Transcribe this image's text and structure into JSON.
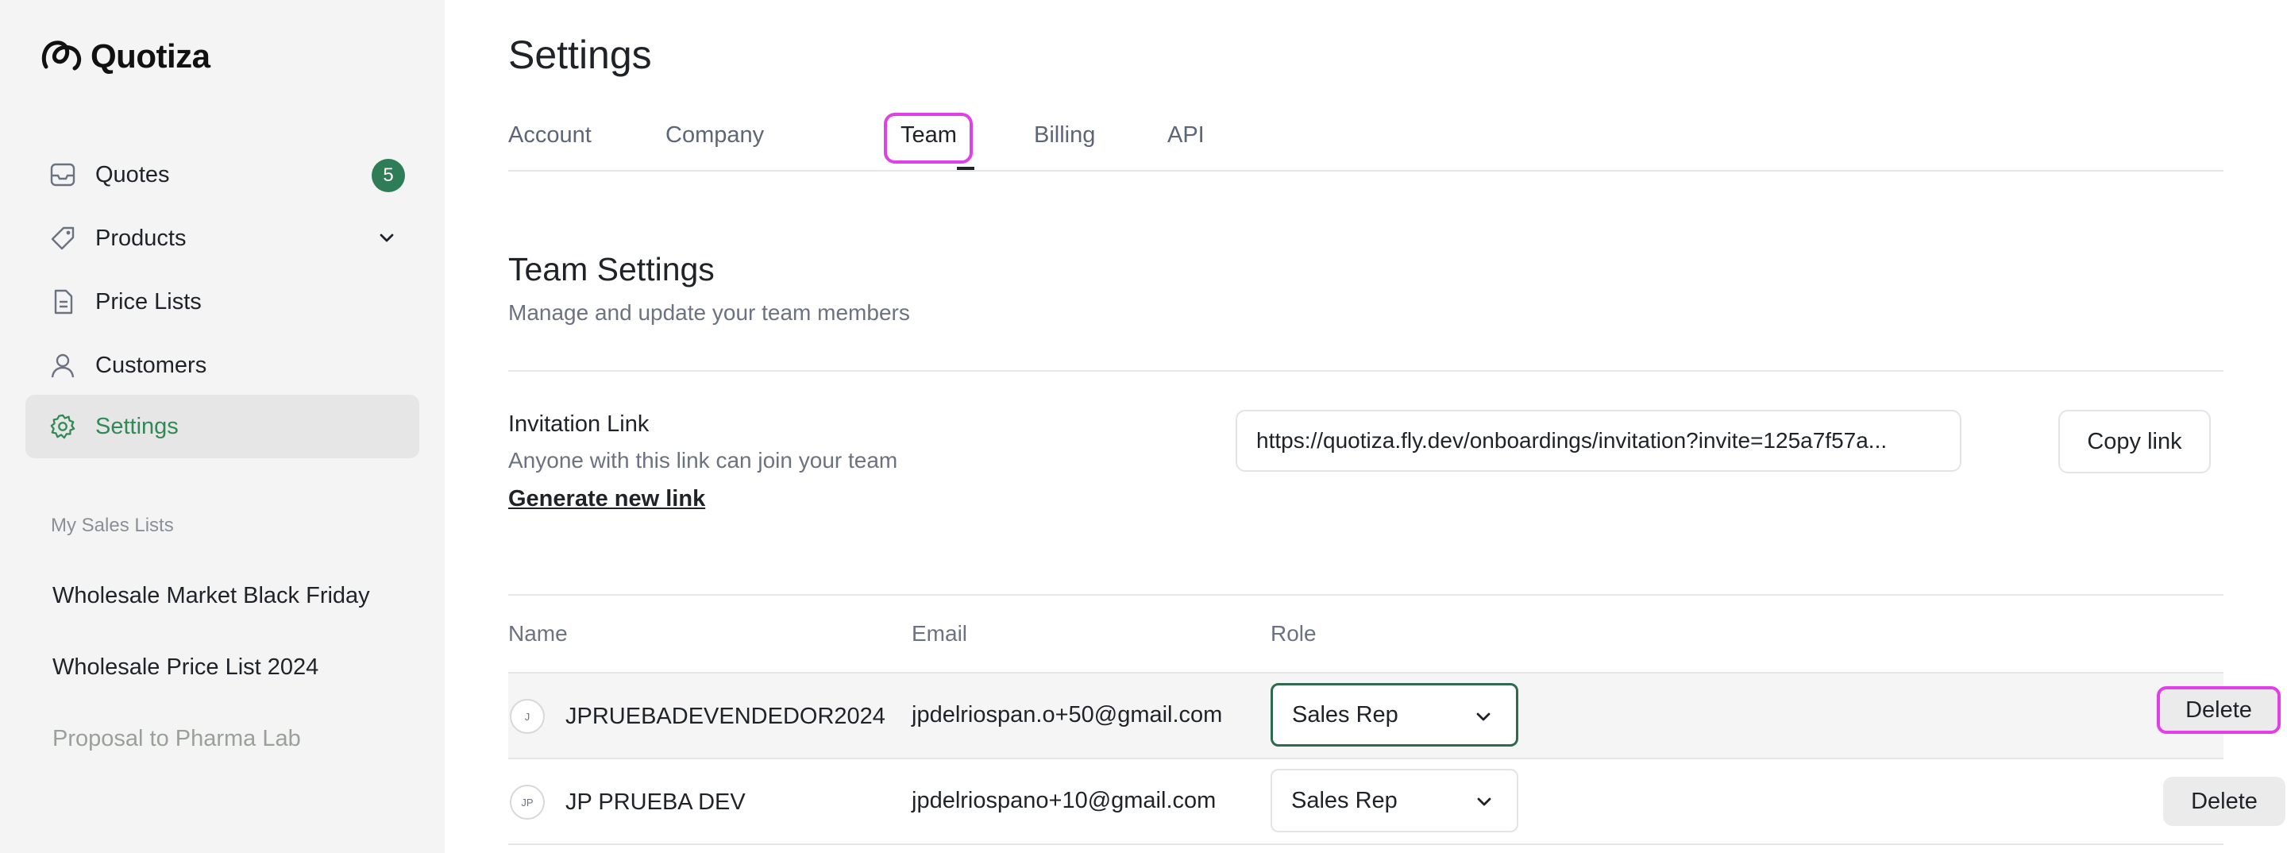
{
  "brand": {
    "name": "Quotiza"
  },
  "sidebar": {
    "items": [
      {
        "label": "Quotes",
        "icon": "inbox-icon",
        "badge": "5"
      },
      {
        "label": "Products",
        "icon": "tag-icon"
      },
      {
        "label": "Price Lists",
        "icon": "document-icon"
      },
      {
        "label": "Customers",
        "icon": "user-icon"
      },
      {
        "label": "Settings",
        "icon": "gear-icon",
        "active": true
      }
    ],
    "section_label": "My Sales Lists",
    "sales_lists": [
      "Wholesale Market Black Friday",
      "Wholesale Price List 2024",
      "Proposal to Pharma Lab"
    ]
  },
  "page": {
    "title": "Settings",
    "tabs": [
      "Account",
      "Company",
      "Team",
      "Billing",
      "API"
    ],
    "active_tab": "Team"
  },
  "team": {
    "heading": "Team Settings",
    "subheading": "Manage and update your team members",
    "invitation": {
      "title": "Invitation Link",
      "description": "Anyone with this link can join your team",
      "generate_label": "Generate new link",
      "url": "https://quotiza.fly.dev/onboardings/invitation?invite=125a7f57a...",
      "copy_label": "Copy link"
    },
    "columns": [
      "Name",
      "Email",
      "Role"
    ],
    "members": [
      {
        "initials": "J",
        "name": "JPRUEBADEVENDEDOR2024",
        "email": "jpdelriospan.o+50@gmail.com",
        "role": "Sales Rep",
        "delete_label": "Delete"
      },
      {
        "initials": "JP",
        "name": "JP PRUEBA DEV",
        "email": "jpdelriospano+10@gmail.com",
        "role": "Sales Rep",
        "delete_label": "Delete"
      }
    ]
  },
  "colors": {
    "accent": "#2f8a56",
    "badge": "#2e7d57",
    "highlight": "#e040e8",
    "sidebar_bg": "#f4f4f4"
  }
}
